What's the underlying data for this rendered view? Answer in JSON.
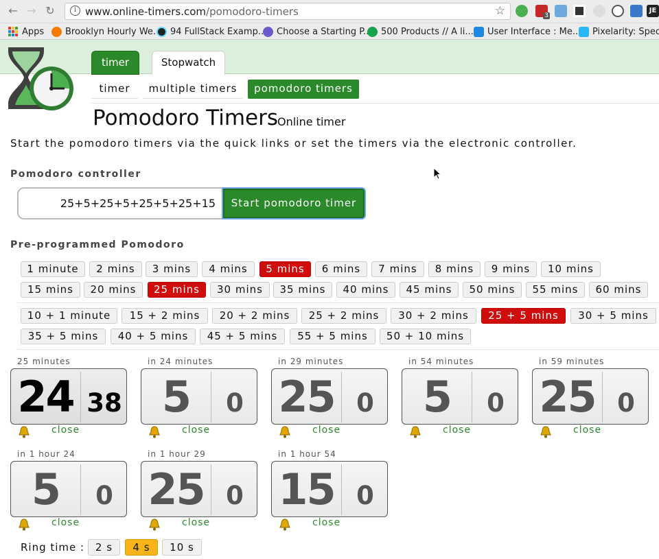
{
  "browser": {
    "url_domain": "www.online-timers.com",
    "url_path": "/pomodoro-timers",
    "bookmarks": [
      "Apps",
      "Brooklyn Hourly We...",
      "94 FullStack Examp...",
      "Choose a Starting P...",
      "500 Products // A li...",
      "User Interface : Me...",
      "Pixelarity: Specta"
    ],
    "ext_badge": "3",
    "ext_last": "JE"
  },
  "site": {
    "top_tabs": [
      "timer",
      "Stopwatch"
    ],
    "sub_tabs": [
      "timer",
      "multiple timers",
      "pomodoro timers"
    ],
    "title": "Pomodoro Timers",
    "subtitle": "Online timer",
    "intro": "Start the pomodoro timers via the quick links or set the timers via the electronic controller."
  },
  "controller": {
    "label": "Pomodoro controller",
    "value": "25+5+25+5+25+5+25+15",
    "button": "Start pomodoro timer"
  },
  "preprogrammed": {
    "label": "Pre-programmed Pomodoro",
    "row1": [
      "1 minute",
      "2 mins",
      "3 mins",
      "4 mins",
      "5 mins",
      "6 mins",
      "7 mins",
      "8 mins",
      "9 mins",
      "10 mins"
    ],
    "row2": [
      "15 mins",
      "20 mins",
      "25 mins",
      "30 mins",
      "35 mins",
      "40 mins",
      "45 mins",
      "50 mins",
      "55 mins",
      "60 mins"
    ],
    "row3": [
      "10 + 1 minute",
      "15 + 2 mins",
      "20 + 2 mins",
      "25 + 2 mins",
      "30 + 2 mins",
      "25 + 5 mins",
      "30 + 5 mins"
    ],
    "row4": [
      "35 + 5 mins",
      "40 + 5 mins",
      "45 + 5 mins",
      "55 + 5 mins",
      "50 + 10 mins"
    ],
    "highlighted": [
      "5 mins",
      "25 mins",
      "25 + 5 mins"
    ],
    "highlight_color": "#d00d0d"
  },
  "timers": [
    {
      "caption": "25 minutes",
      "minutes": "24",
      "seconds": "38",
      "close": "close"
    },
    {
      "caption": "in 24 minutes",
      "minutes": "5",
      "seconds": "0",
      "close": "close"
    },
    {
      "caption": "in 29 minutes",
      "minutes": "25",
      "seconds": "0",
      "close": "close"
    },
    {
      "caption": "in 54 minutes",
      "minutes": "5",
      "seconds": "0",
      "close": "close"
    },
    {
      "caption": "in 59 minutes",
      "minutes": "25",
      "seconds": "0",
      "close": "close"
    },
    {
      "caption": "in 1 hour 24",
      "minutes": "5",
      "seconds": "0",
      "close": "close"
    },
    {
      "caption": "in 1 hour 29",
      "minutes": "25",
      "seconds": "0",
      "close": "close"
    },
    {
      "caption": "in 1 hour 54",
      "minutes": "15",
      "seconds": "0",
      "close": "close"
    }
  ],
  "ring": {
    "label": "Ring time :",
    "options": [
      "2 s",
      "4 s",
      "10 s"
    ],
    "selected": "4 s",
    "selected_color": "#f7b31a"
  },
  "colors": {
    "brand_green": "#2a8a2a",
    "header_band": "#dcefdc"
  },
  "icons": [
    "back-arrow-icon",
    "forward-arrow-icon",
    "reload-icon",
    "info-icon",
    "bookmark-star-icon",
    "apps-grid-icon",
    "bell-icon",
    "hourglass-clock-logo",
    "mouse-cursor-icon"
  ]
}
